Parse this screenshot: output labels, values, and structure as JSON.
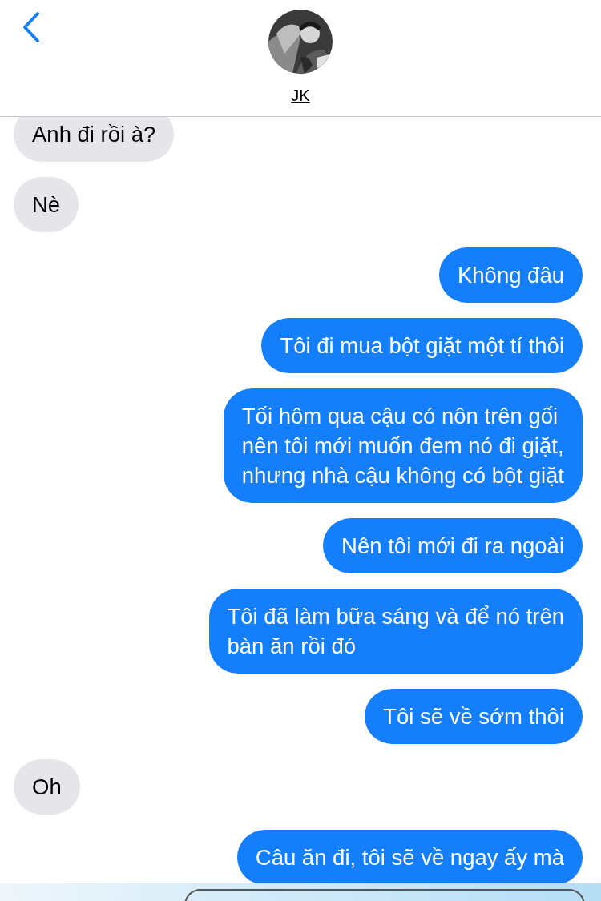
{
  "header": {
    "contact_name": "JK"
  },
  "messages": [
    {
      "kind": "incoming",
      "lines": [
        "Anh đi rồi à?"
      ]
    },
    {
      "kind": "incoming",
      "lines": [
        "Nè"
      ]
    },
    {
      "kind": "outgoing",
      "lines": [
        "Không đâu"
      ]
    },
    {
      "kind": "outgoing",
      "lines": [
        "Tôi đi mua bột giặt một tí thôi"
      ]
    },
    {
      "kind": "outgoing",
      "lines": [
        "Tối hôm qua cậu có nôn trên gối",
        "nên tôi mới muốn đem nó đi giặt,",
        "nhưng nhà cậu không có bột giặt"
      ]
    },
    {
      "kind": "outgoing",
      "lines": [
        "Nên tôi mới đi ra ngoài"
      ]
    },
    {
      "kind": "outgoing",
      "lines": [
        "Tôi đã làm bữa sáng và để nó trên",
        "bàn ăn rồi đó"
      ]
    },
    {
      "kind": "outgoing",
      "lines": [
        "Tôi sẽ về sớm thôi"
      ]
    },
    {
      "kind": "incoming",
      "lines": [
        "Oh"
      ]
    },
    {
      "kind": "outgoing",
      "lines": [
        "Câu ăn đi, tôi sẽ về ngay ấy mà"
      ]
    }
  ]
}
